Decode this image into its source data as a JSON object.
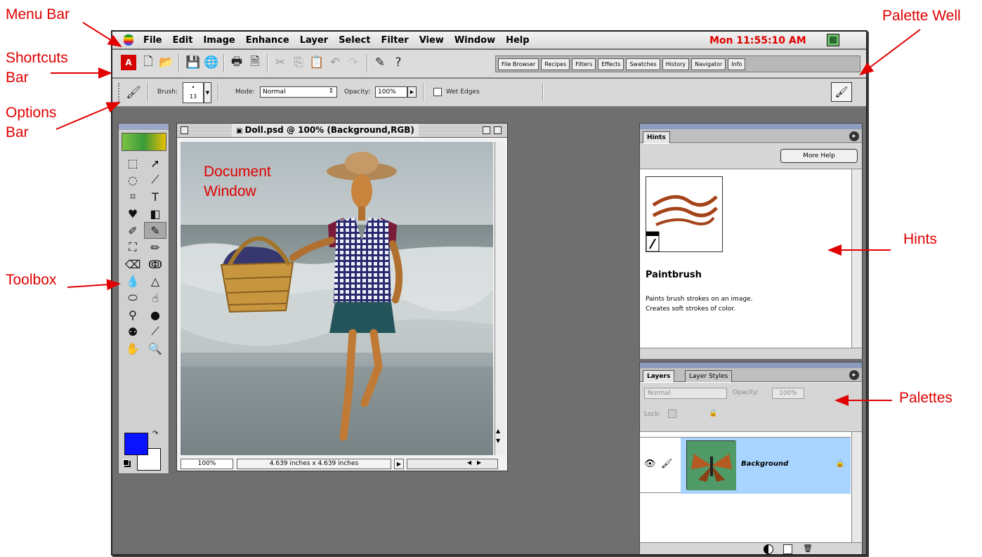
{
  "callouts": {
    "menu_bar": "Menu Bar",
    "shortcuts_bar_1": "Shortcuts",
    "shortcuts_bar_2": "Bar",
    "options_bar_1": "Options",
    "options_bar_2": "Bar",
    "toolbox": "Toolbox",
    "palette_well": "Palette Well",
    "hints": "Hints",
    "palettes": "Palettes",
    "document_window_1": "Document",
    "document_window_2": "Window"
  },
  "menubar": {
    "items": [
      "File",
      "Edit",
      "Image",
      "Enhance",
      "Layer",
      "Select",
      "Filter",
      "View",
      "Window",
      "Help"
    ],
    "clock": "Mon 11:55:10 AM"
  },
  "palette_well": {
    "tabs": [
      "File Browser",
      "Recipes",
      "Filters",
      "Effects",
      "Swatches",
      "History",
      "Navigator",
      "Info"
    ]
  },
  "options_bar": {
    "brush_label": "Brush:",
    "brush_size": "13",
    "mode_label": "Mode:",
    "mode_value": "Normal",
    "opacity_label": "Opacity:",
    "opacity_value": "100%",
    "wet_edges_label": "Wet Edges"
  },
  "document": {
    "title": "Doll.psd @ 100% (Background,RGB)",
    "zoom": "100%",
    "size": "4.639 inches x 4.639 inches"
  },
  "hints": {
    "tab": "Hints",
    "more_help": "More Help",
    "tool_name": "Paintbrush",
    "desc_line1": "Paints brush strokes on an image.",
    "desc_line2": "Creates soft strokes of color."
  },
  "layers": {
    "tab1": "Layers",
    "tab2": "Layer Styles",
    "mode": "Normal",
    "opacity_label": "Opacity:",
    "opacity_value": "100%",
    "lock_label": "Lock:",
    "layer_name": "Background"
  },
  "colors": {
    "callout": "#e00000",
    "foreground": "#0a12ff",
    "background": "#ffffff",
    "layer_highlight": "#a8d4ff"
  }
}
